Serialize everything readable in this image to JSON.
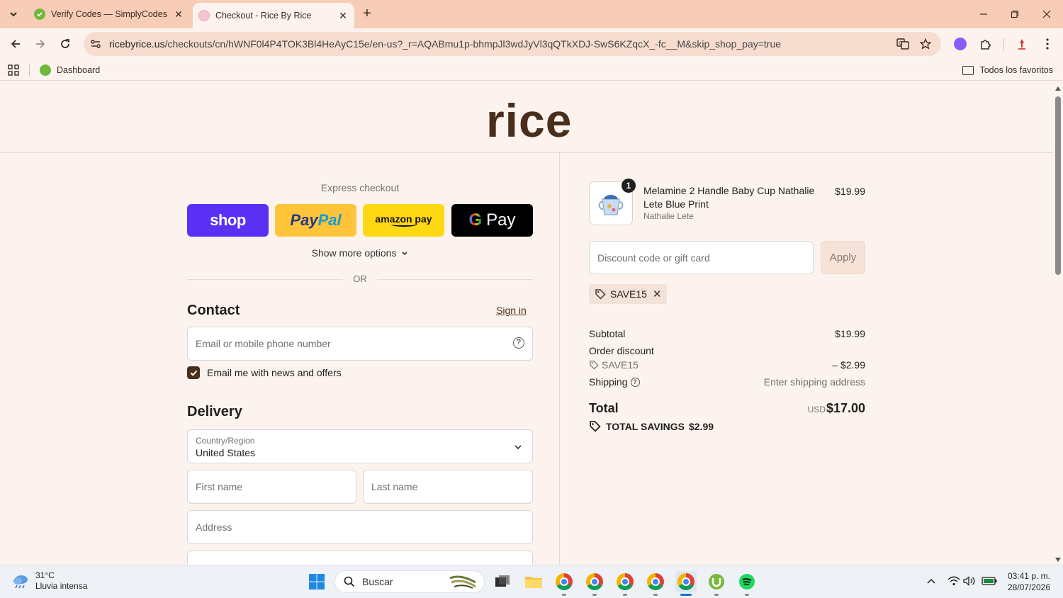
{
  "browser": {
    "tabs": [
      {
        "title": "Verify Codes — SimplyCodes",
        "active": false
      },
      {
        "title": "Checkout - Rice By Rice",
        "active": true
      }
    ],
    "url_host": "ricebyrice.us",
    "url_path": "/checkouts/cn/hWNF0l4P4TOK3Bl4HeAyC15e/en-us?_r=AQABmu1p-bhmpJl3wdJyVl3qQTkXDJ-SwS6KZqcX_-fc__M&skip_shop_pay=true",
    "bookmarks": {
      "dashboard": "Dashboard",
      "all_favorites": "Todos los favoritos"
    }
  },
  "store": {
    "logo": "rice"
  },
  "express": {
    "title": "Express checkout",
    "shop": "shop",
    "paypal_pay": "Pay",
    "paypal_pal": "Pal",
    "amazon": "amazon pay",
    "gpay": "Pay",
    "more_options": "Show more options",
    "or": "OR"
  },
  "contact": {
    "title": "Contact",
    "sign_in": "Sign in",
    "email_placeholder": "Email or mobile phone number",
    "news_label": "Email me with news and offers",
    "news_checked": true
  },
  "delivery": {
    "title": "Delivery",
    "country_label": "Country/Region",
    "country_value": "United States",
    "first_name_placeholder": "First name",
    "last_name_placeholder": "Last name",
    "address_placeholder": "Address"
  },
  "order": {
    "item": {
      "quantity": "1",
      "name": "Melamine 2 Handle Baby Cup Nathalie Lete Blue Print",
      "vendor": "Nathalie Lete",
      "price": "$19.99"
    },
    "discount_placeholder": "Discount code or gift card",
    "apply_label": "Apply",
    "applied_code": "SAVE15",
    "subtotal_label": "Subtotal",
    "subtotal_value": "$19.99",
    "order_discount_label": "Order discount",
    "discount_code": "SAVE15",
    "discount_value": "– $2.99",
    "shipping_label": "Shipping",
    "shipping_value": "Enter shipping address",
    "total_label": "Total",
    "total_currency": "USD",
    "total_value": "$17.00",
    "savings_label": "TOTAL SAVINGS",
    "savings_value": "$2.99"
  },
  "taskbar": {
    "temperature": "31°C",
    "weather": "Lluvia intensa",
    "search": "Buscar",
    "time": "03:41 p. m.",
    "date": "28/07/2026"
  },
  "colors": {
    "accent": "#4a2e1c",
    "shop": "#5a31f4",
    "paypal": "#ffc439",
    "amazon": "#ffd814",
    "gpay": "#000000",
    "tabstrip": "#f7cdb7"
  }
}
